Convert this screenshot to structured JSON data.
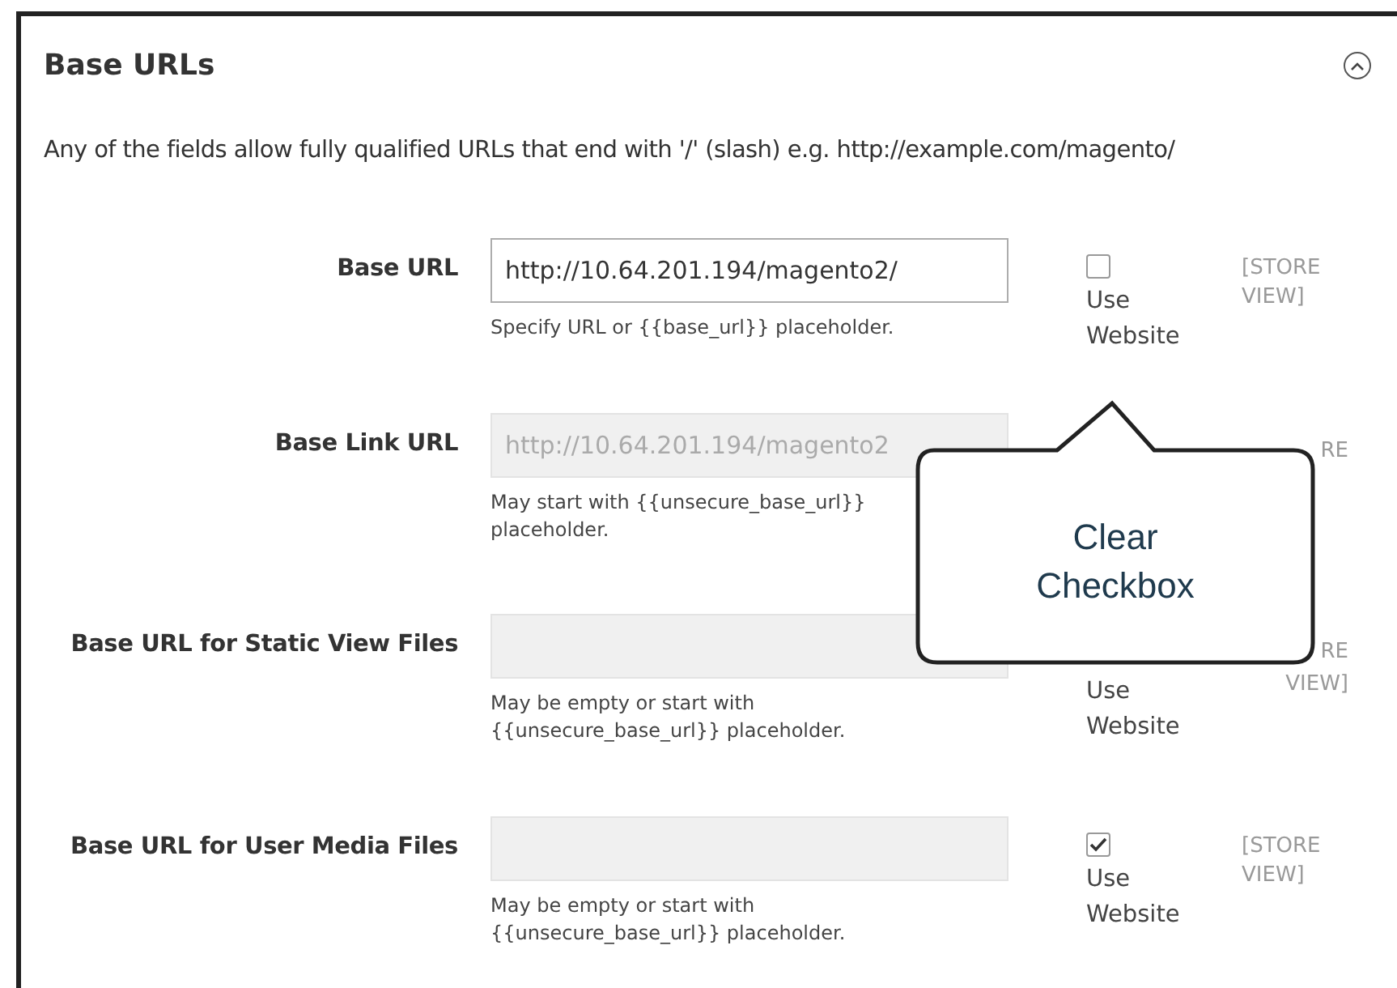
{
  "section": {
    "title": "Base URLs",
    "expanded": true,
    "description": "Any of the fields allow fully qualified URLs that end with '/' (slash) e.g. http://example.com/magento/"
  },
  "rows": [
    {
      "label": "Base URL",
      "value": "http://10.64.201.194/magento2/",
      "disabled": false,
      "hint": "Specify URL or {{base_url}} placeholder.",
      "checkbox": {
        "checked": false
      },
      "use_website": "Use Website",
      "scope": [
        "[STORE",
        "VIEW]"
      ]
    },
    {
      "label": "Base Link URL",
      "value": "http://10.64.201.194/magento2",
      "disabled": true,
      "hint": "May start with {{unsecure_base_url}} placeholder.",
      "scope": [
        "RE"
      ],
      "scope_cut": true
    },
    {
      "label": "Base URL for Static View Files",
      "value": "",
      "disabled": true,
      "hint": "May be empty or start with {{unsecure_base_url}} placeholder.",
      "use_website": "Use Website",
      "scope": [
        "RE",
        "VIEW]"
      ],
      "scope_cut": true
    },
    {
      "label": "Base URL for User Media Files",
      "value": "",
      "disabled": true,
      "hint": "May be empty or start with {{unsecure_base_url}} placeholder.",
      "checkbox": {
        "checked": true
      },
      "use_website": "Use Website",
      "scope": [
        "[STORE",
        "VIEW]"
      ]
    }
  ],
  "callout": {
    "text": "Clear Checkbox"
  }
}
